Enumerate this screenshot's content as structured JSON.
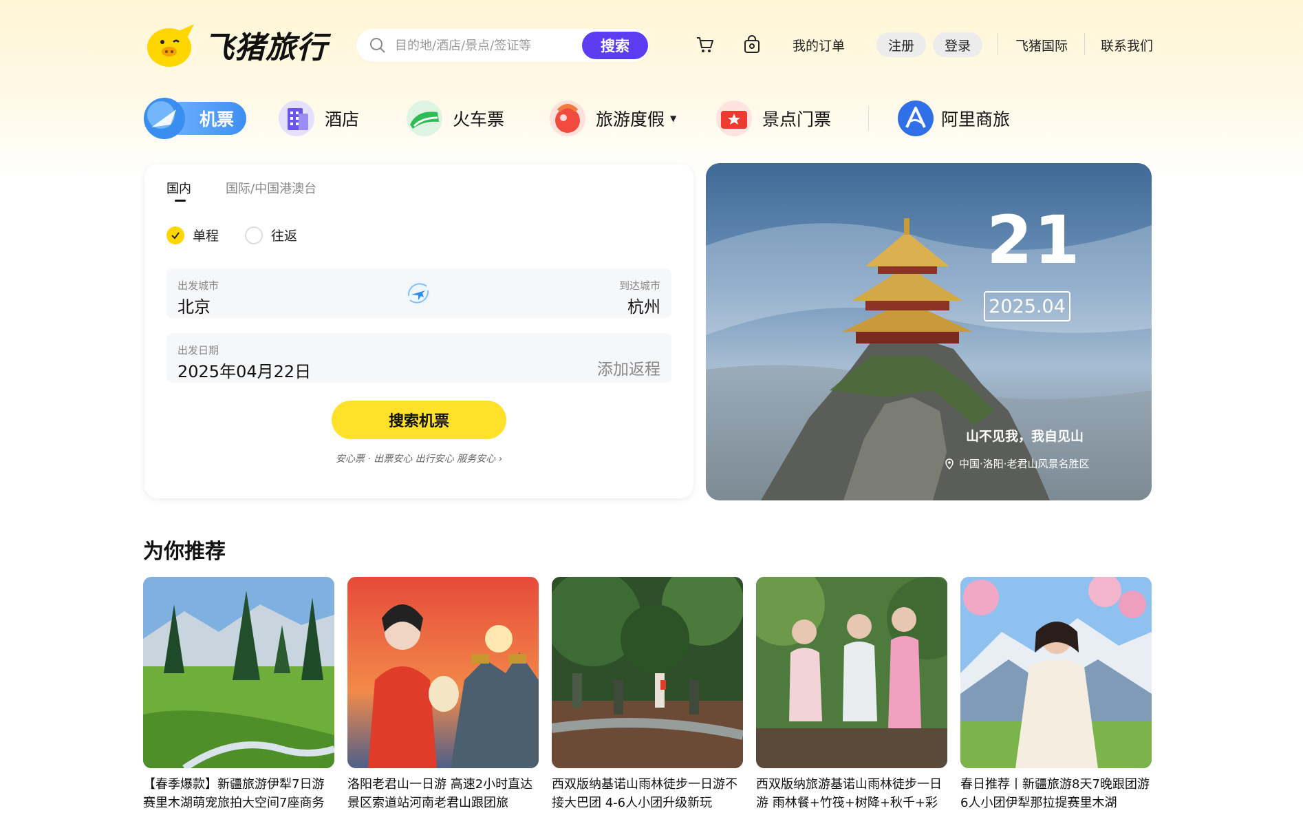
{
  "header": {
    "logo_text": "飞猪旅行",
    "search_placeholder": "目的地/酒店/景点/签证等",
    "search_button": "搜索",
    "cart_icon": "cart-icon",
    "bag_icon": "bag-icon",
    "my_orders": "我的订单",
    "register": "注册",
    "login": "登录",
    "intl": "飞猪国际",
    "contact": "联系我们"
  },
  "nav": {
    "items": [
      {
        "label": "机票",
        "icon": "plane-icon",
        "active": true
      },
      {
        "label": "酒店",
        "icon": "hotel-icon"
      },
      {
        "label": "火车票",
        "icon": "train-icon"
      },
      {
        "label": "旅游度假",
        "icon": "vacation-icon",
        "has_dropdown": true
      },
      {
        "label": "景点门票",
        "icon": "ticket-icon"
      },
      {
        "label": "阿里商旅",
        "icon": "business-travel-icon"
      }
    ]
  },
  "booking": {
    "tabs": [
      {
        "label": "国内",
        "active": true
      },
      {
        "label": "国际/中国港澳台",
        "active": false
      }
    ],
    "trip_types": [
      {
        "label": "单程",
        "selected": true
      },
      {
        "label": "往返",
        "selected": false
      }
    ],
    "from_label": "出发城市",
    "from_value": "北京",
    "to_label": "到达城市",
    "to_value": "杭州",
    "date_label": "出发日期",
    "date_value": "2025年04月22日",
    "add_return": "添加返程",
    "search_button": "搜索机票",
    "assurance": "安心票 · 出票安心 出行安心 服务安心 ›"
  },
  "hero": {
    "day": "21",
    "month": "2025.04",
    "caption": "山不见我，我自见山",
    "location": "中国·洛阳·老君山风景名胜区"
  },
  "recommend": {
    "title": "为你推荐",
    "items": [
      {
        "text": "【春季爆款】新疆旅游伊犁7日游赛里木湖萌宠旅拍大空间7座商务"
      },
      {
        "text": "洛阳老君山一日游 高速2小时直达景区索道站河南老君山跟团旅"
      },
      {
        "text": "西双版纳基诺山雨林徒步一日游不接大巴团 4-6人小团升级新玩"
      },
      {
        "text": "西双版纳旅游基诺山雨林徒步一日游 雨林餐+竹筏+树降+秋千+彩"
      },
      {
        "text": "春日推荐丨新疆旅游8天7晚跟团游6人小团伊犁那拉提赛里木湖"
      }
    ]
  },
  "colors": {
    "brand_yellow": "#ffe12a",
    "search_purple": "#5b3cf0",
    "active_blue": "#4a97f5"
  }
}
